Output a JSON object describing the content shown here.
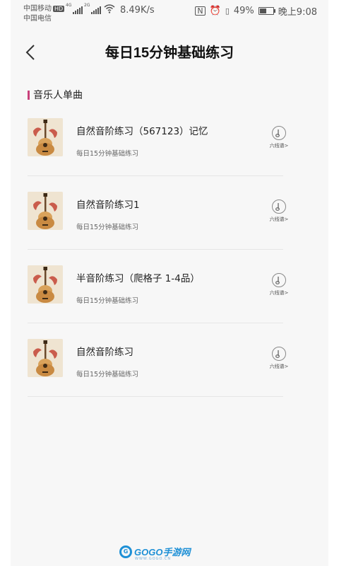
{
  "status_bar": {
    "carrier_1": "中国移动",
    "carrier_1_badge": "HD",
    "carrier_2": "中国电信",
    "net_1": "4G",
    "net_2": "2G",
    "net_speed": "8.49K/s",
    "battery": "49%",
    "time": "晚上9:08",
    "icons": [
      "nfc-icon",
      "alarm-icon",
      "vibrate-icon",
      "battery-icon"
    ]
  },
  "header": {
    "title": "每日15分钟基础练习",
    "back_icon": "chevron-left-icon"
  },
  "section": {
    "title": "音乐人单曲",
    "accent_color": "#c8407a"
  },
  "songs": [
    {
      "title": "自然音阶练习（567123）记忆",
      "subtitle": "每日15分钟基础练习",
      "action_label": "六线谱>"
    },
    {
      "title": "自然音阶练习1",
      "subtitle": "每日15分钟基础练习",
      "action_label": "六线谱>"
    },
    {
      "title": "半音阶练习（爬格子 1-4品）",
      "subtitle": "每日15分钟基础练习",
      "action_label": "六线谱>"
    },
    {
      "title": "自然音阶练习",
      "subtitle": "每日15分钟基础练习",
      "action_label": "六线谱>"
    }
  ],
  "watermark": {
    "text": "GOGO手游网",
    "sub": "WWW.GOGO.CN",
    "color": "#1e90d6"
  }
}
